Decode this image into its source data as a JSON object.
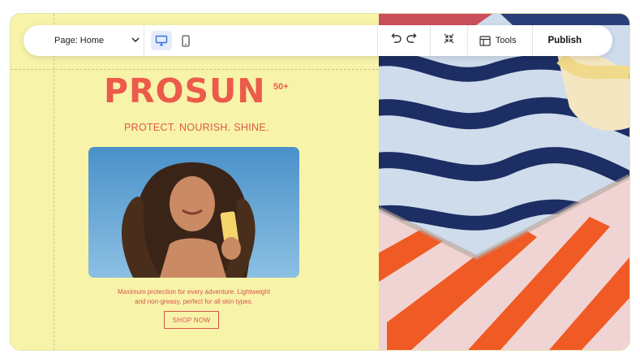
{
  "toolbar": {
    "page_label": "Page: Home",
    "tools_label": "Tools",
    "publish_label": "Publish"
  },
  "content": {
    "brand": "PROSUN",
    "brand_sup": "50+",
    "tagline": "PROTECT. NOURISH. SHINE.",
    "desc_line1": "Maximum protection for every adventure. Lightweight",
    "desc_line2": "and non-greasy, perfect for all skin types.",
    "cta": "SHOP NOW"
  },
  "colors": {
    "brand": "#ec5a4a",
    "panel": "#f7f3a9",
    "accent": "#e4ecfb"
  },
  "icons": [
    "chevron-down-icon",
    "desktop-icon",
    "mobile-icon",
    "undo-icon",
    "redo-icon",
    "shrink-icon",
    "tools-panel-icon"
  ]
}
